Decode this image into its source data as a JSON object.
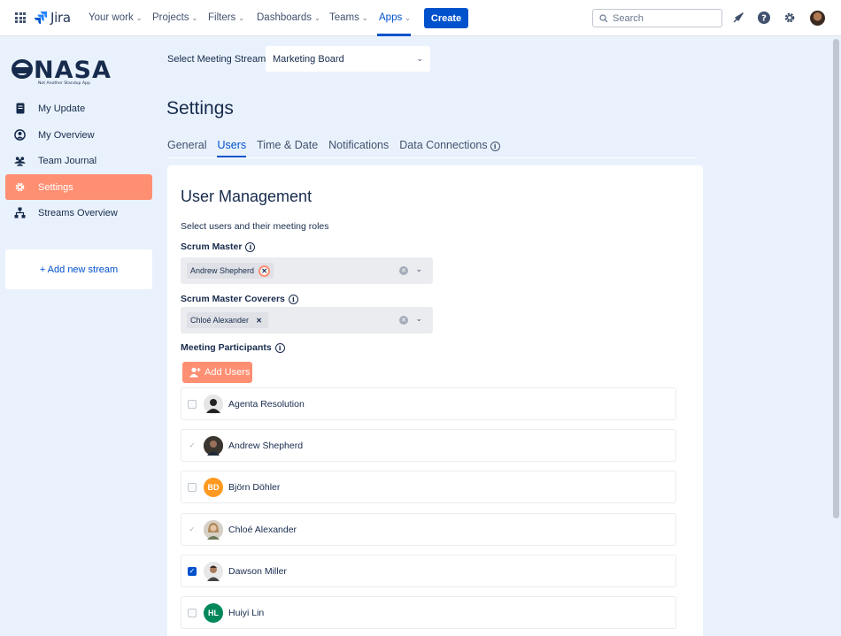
{
  "topnav": {
    "logo_text": "Jira",
    "items": [
      {
        "label": "Your work",
        "chevron": true
      },
      {
        "label": "Projects",
        "chevron": true
      },
      {
        "label": "Filters",
        "chevron": true
      },
      {
        "label": "Dashboards",
        "chevron": true
      },
      {
        "label": "Teams",
        "chevron": true
      },
      {
        "label": "Apps",
        "chevron": true,
        "active": true
      }
    ],
    "create_label": "Create",
    "search_placeholder": "Search"
  },
  "sidebar": {
    "logo_text": "NASA",
    "logo_subtitle": "Not Another Standup App",
    "items": [
      {
        "label": "My Update",
        "icon": "document-icon"
      },
      {
        "label": "My Overview",
        "icon": "user-circle-icon"
      },
      {
        "label": "Team Journal",
        "icon": "people-icon"
      },
      {
        "label": "Settings",
        "icon": "gear-icon",
        "active": true
      },
      {
        "label": "Streams Overview",
        "icon": "hierarchy-icon"
      }
    ],
    "add_stream_label": "+ Add new stream"
  },
  "stream": {
    "label": "Select Meeting Stream",
    "value": "Marketing Board"
  },
  "page_title": "Settings",
  "tabs": [
    {
      "label": "General"
    },
    {
      "label": "Users",
      "active": true
    },
    {
      "label": "Time & Date"
    },
    {
      "label": "Notifications"
    },
    {
      "label": "Data Connections",
      "info": true
    }
  ],
  "user_management": {
    "title": "User Management",
    "subtitle": "Select users and their meeting roles",
    "scrum_master_label": "Scrum Master",
    "scrum_master_value": "Andrew Shepherd",
    "coverers_label": "Scrum Master Coverers",
    "coverers_value": "Chloé Alexander",
    "participants_label": "Meeting Participants",
    "add_users_label": "Add Users"
  },
  "participants": [
    {
      "name": "Agenta Resolution",
      "initials": "",
      "state": "unchecked",
      "avatar_color": "#d8d8d8"
    },
    {
      "name": "Andrew Shepherd",
      "initials": "",
      "state": "disabled-checked",
      "avatar_color": "#5a4a42"
    },
    {
      "name": "Björn Döhler",
      "initials": "BD",
      "state": "unchecked",
      "avatar_color": "#ff991f"
    },
    {
      "name": "Chloé Alexander",
      "initials": "",
      "state": "disabled-checked",
      "avatar_color": "#c8a88a"
    },
    {
      "name": "Dawson Miller",
      "initials": "",
      "state": "checked",
      "avatar_color": "#8a6a55"
    },
    {
      "name": "Huiyi Lin",
      "initials": "HL",
      "state": "unchecked",
      "avatar_color": "#00875a"
    }
  ],
  "colors": {
    "accent": "#0052cc",
    "brand_orange": "#ff8f73",
    "background": "#e9f2fc"
  }
}
